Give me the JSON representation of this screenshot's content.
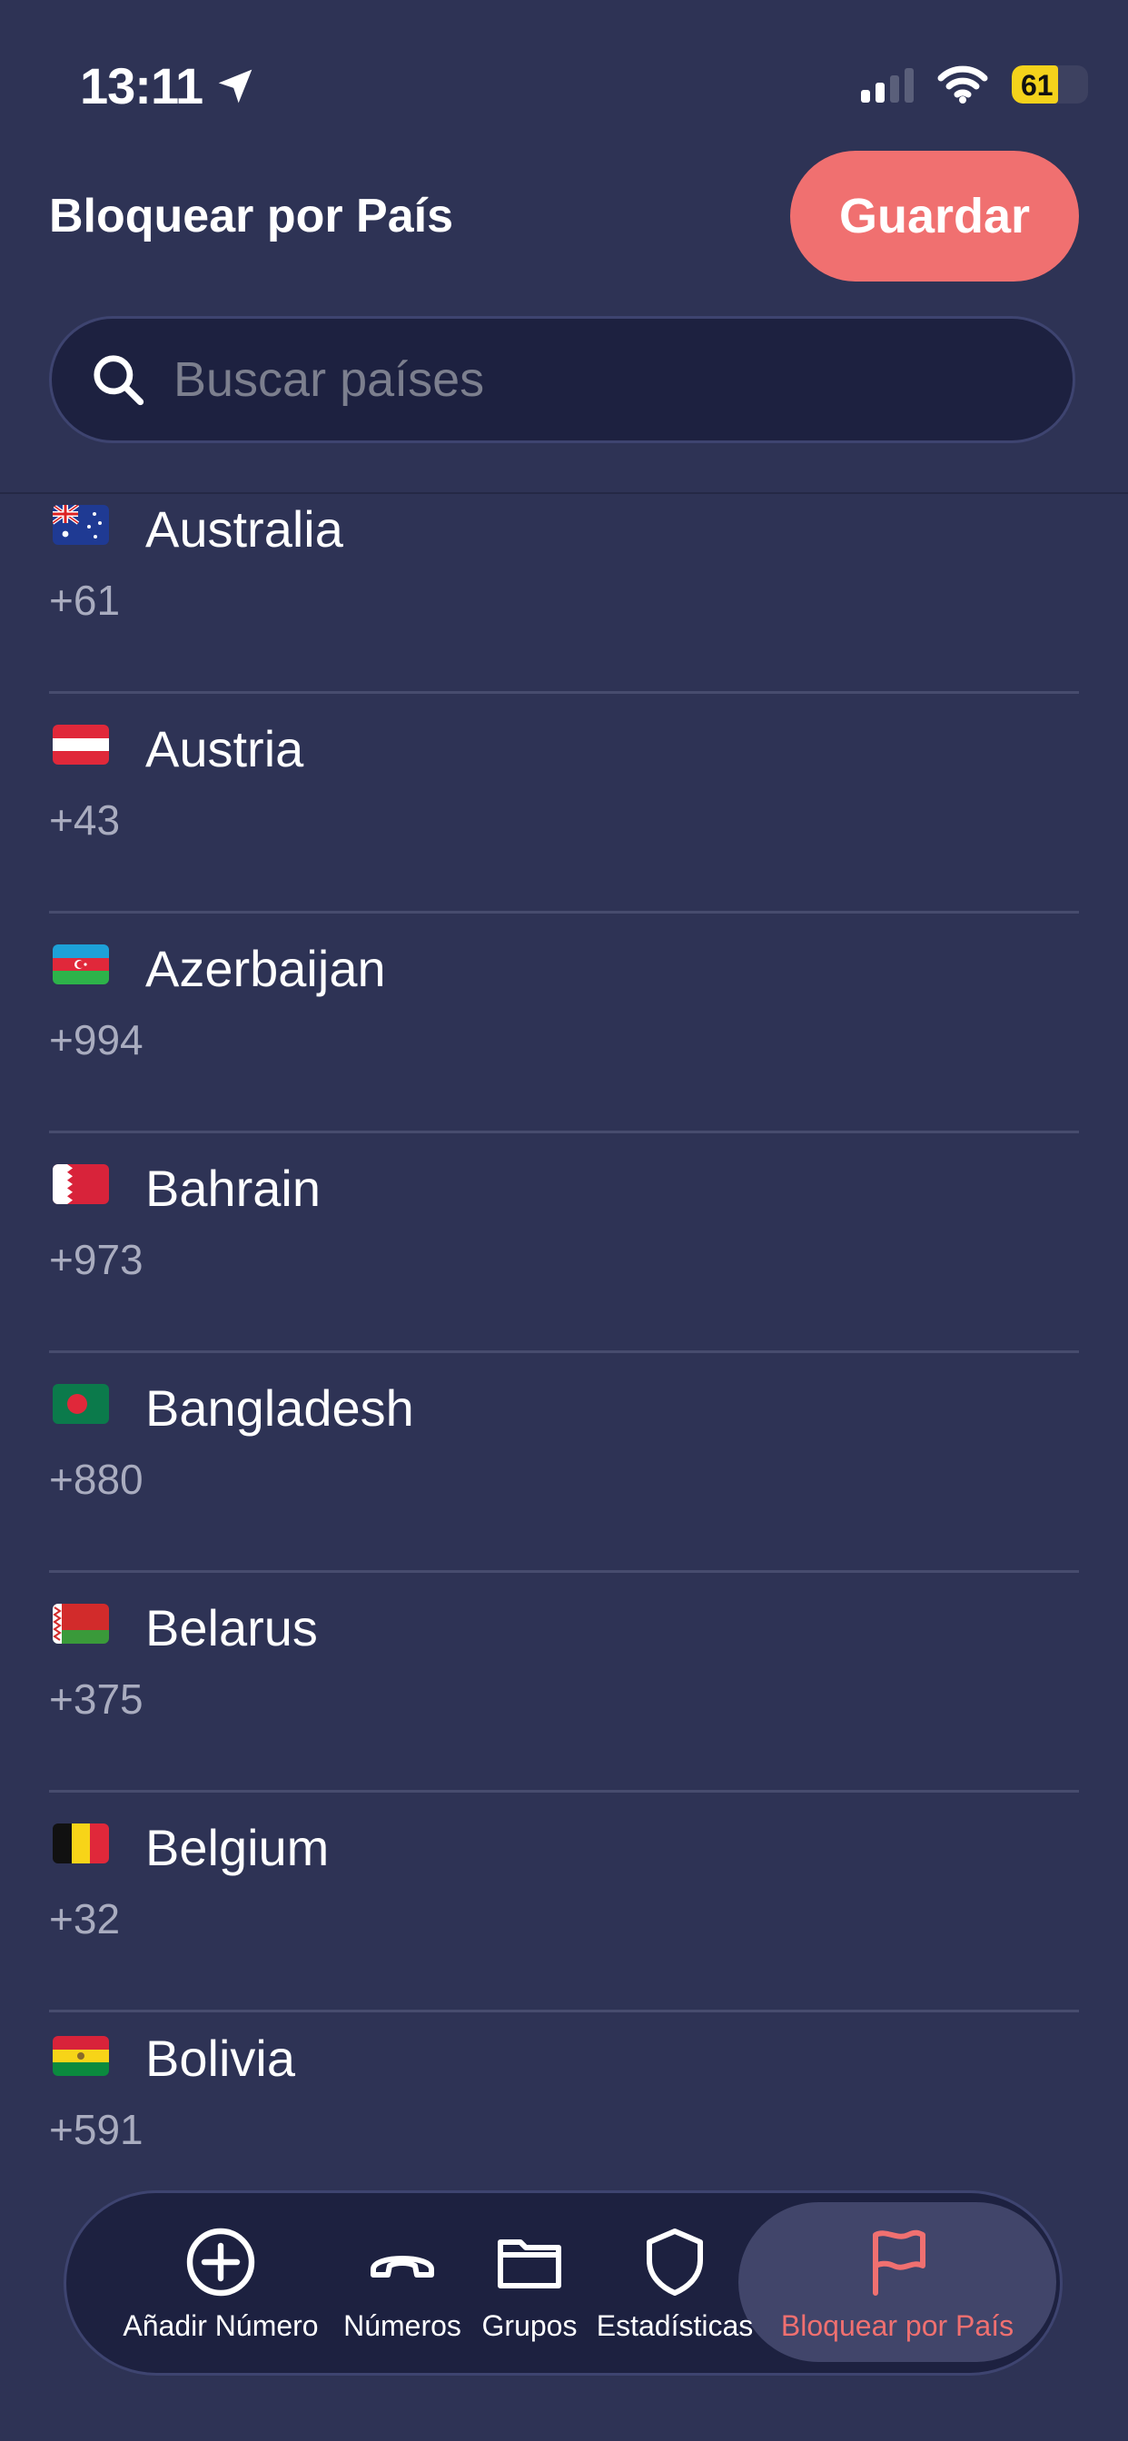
{
  "status_bar": {
    "time": "13:11",
    "battery": "61",
    "battery_level": 0.61,
    "signal_bars_active": 2
  },
  "header": {
    "title": "Bloquear por País",
    "save_label": "Guardar"
  },
  "search": {
    "placeholder": "Buscar países",
    "value": ""
  },
  "countries": [
    {
      "name": "Australia",
      "code": "+61",
      "flag": "australia-flag-icon"
    },
    {
      "name": "Austria",
      "code": "+43",
      "flag": "austria-flag-icon"
    },
    {
      "name": "Azerbaijan",
      "code": "+994",
      "flag": "azerbaijan-flag-icon"
    },
    {
      "name": "Bahrain",
      "code": "+973",
      "flag": "bahrain-flag-icon"
    },
    {
      "name": "Bangladesh",
      "code": "+880",
      "flag": "bangladesh-flag-icon"
    },
    {
      "name": "Belarus",
      "code": "+375",
      "flag": "belarus-flag-icon"
    },
    {
      "name": "Belgium",
      "code": "+32",
      "flag": "belgium-flag-icon"
    },
    {
      "name": "Bolivia",
      "code": "+591",
      "flag": "bolivia-flag-icon"
    }
  ],
  "tabs": [
    {
      "label": "Añadir Número",
      "icon": "plus-circle-icon",
      "active": false
    },
    {
      "label": "Números",
      "icon": "phone-icon",
      "active": false
    },
    {
      "label": "Grupos",
      "icon": "folder-icon",
      "active": false
    },
    {
      "label": "Estadísticas",
      "icon": "shield-icon",
      "active": false
    },
    {
      "label": "Bloquear por País",
      "icon": "flag-icon",
      "active": true
    }
  ],
  "colors": {
    "background": "#2e3355",
    "accent": "#f07070",
    "search_bg": "#1d2140",
    "secondary_text": "#a9acbf"
  }
}
